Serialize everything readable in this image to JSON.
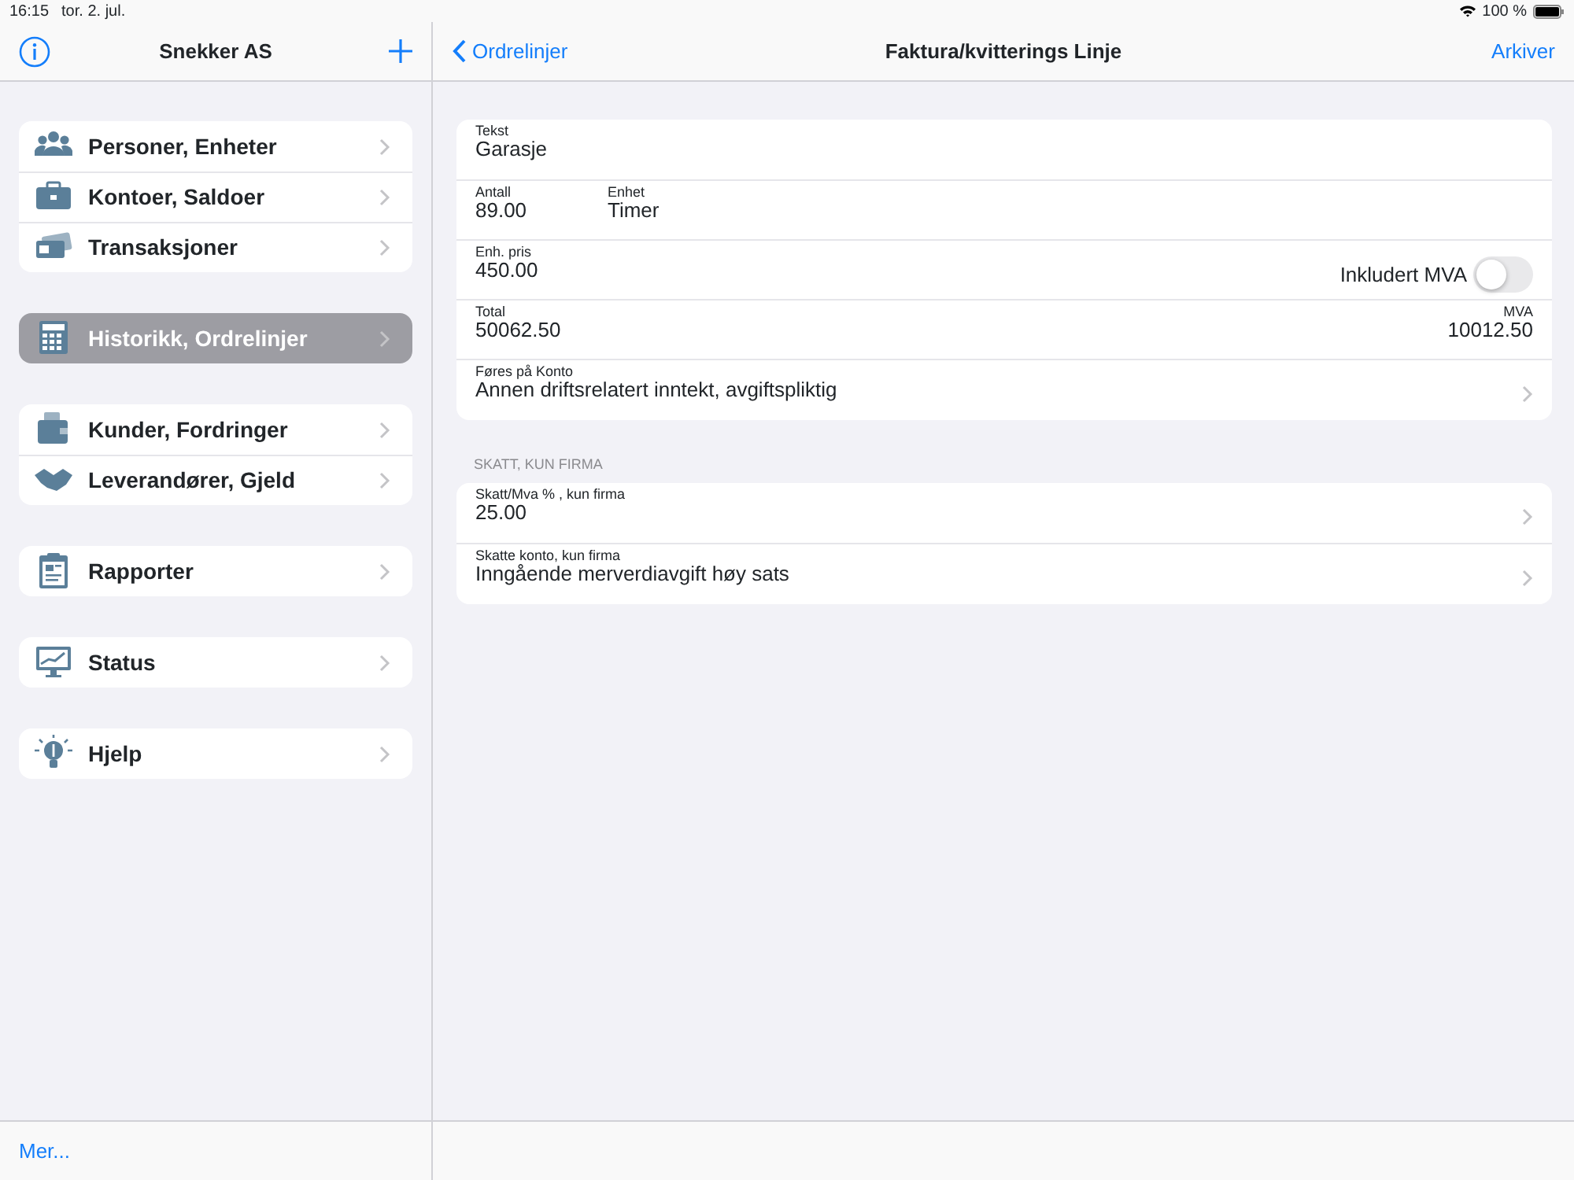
{
  "status_bar": {
    "time": "16:15",
    "date": "tor. 2. jul.",
    "battery": "100 %"
  },
  "sidebar": {
    "title": "Snekker AS",
    "groups": [
      {
        "items": [
          {
            "label": "Personer, Enheter",
            "selected": false
          },
          {
            "label": "Kontoer, Saldoer",
            "selected": false
          },
          {
            "label": "Transaksjoner",
            "selected": false
          }
        ]
      },
      {
        "items": [
          {
            "label": "Historikk, Ordrelinjer",
            "selected": true
          }
        ]
      },
      {
        "items": [
          {
            "label": "Kunder, Fordringer",
            "selected": false
          },
          {
            "label": "Leverandører, Gjeld",
            "selected": false
          }
        ]
      },
      {
        "items": [
          {
            "label": "Rapporter",
            "selected": false
          }
        ]
      },
      {
        "items": [
          {
            "label": "Status",
            "selected": false
          }
        ]
      },
      {
        "items": [
          {
            "label": "Hjelp",
            "selected": false
          }
        ]
      }
    ],
    "footer_link": "Mer..."
  },
  "detail": {
    "back": "Ordrelinjer",
    "title": "Faktura/kvitterings Linje",
    "action": "Arkiver",
    "sections": [
      {
        "rows": [
          {
            "kind": "field",
            "label": "Tekst",
            "value": "Garasje"
          },
          {
            "kind": "pair",
            "label": "Antall",
            "value": "89.00",
            "label2": "Enhet",
            "value2": "Timer"
          },
          {
            "kind": "toggle",
            "label": "Enh. pris",
            "value": "450.00",
            "toggle_label": "Inkludert MVA",
            "on": false
          },
          {
            "kind": "split",
            "label": "Total",
            "value": "50062.50",
            "label2": "MVA",
            "value2": "10012.50"
          },
          {
            "kind": "link",
            "label": "Føres på Konto",
            "value": "Annen driftsrelatert inntekt, avgiftspliktig"
          }
        ]
      },
      {
        "header": "SKATT, KUN FIRMA",
        "rows": [
          {
            "kind": "link",
            "label": "Skatt/Mva % , kun firma",
            "value": "25.00"
          },
          {
            "kind": "link",
            "label": "Skatte konto, kun firma",
            "value": "Inngående merverdiavgift høy sats"
          }
        ]
      }
    ]
  }
}
